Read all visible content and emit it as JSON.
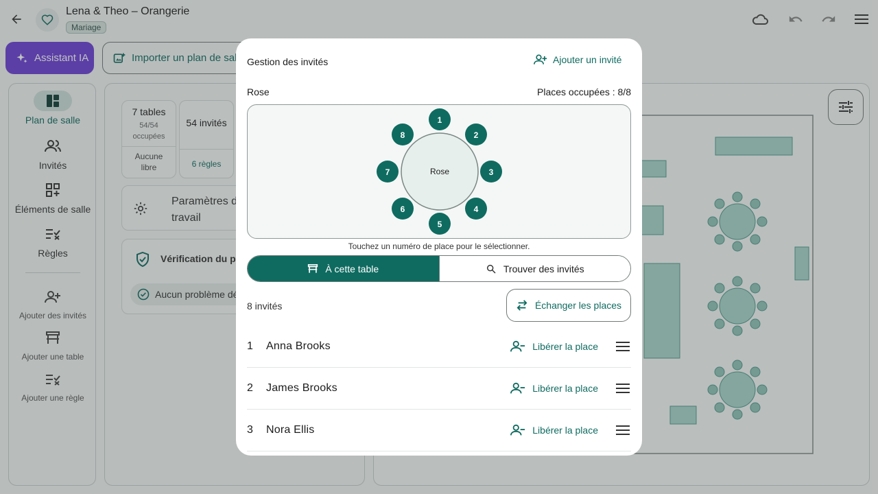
{
  "app": {
    "title": "Lena & Theo – Orangerie",
    "event_badge": "Mariage",
    "assistant_label": "Assistant IA",
    "import_label": "Importer un plan de salle"
  },
  "sidebar": {
    "items": [
      {
        "label": "Plan de salle",
        "icon": "floor-plan-icon"
      },
      {
        "label": "Invités",
        "icon": "guests-icon"
      },
      {
        "label": "Éléments de salle",
        "icon": "room-elements-icon"
      },
      {
        "label": "Règles",
        "icon": "rules-icon"
      }
    ],
    "actions": [
      {
        "label": "Ajouter des invités",
        "icon": "add-person-icon"
      },
      {
        "label": "Ajouter une table",
        "icon": "table-icon"
      },
      {
        "label": "Ajouter une règle",
        "icon": "add-rule-icon"
      }
    ]
  },
  "summary": {
    "tables": "7 tables",
    "tables_sub": "54/54 occupées",
    "tables_free": "Aucune libre",
    "guests": "54 invités",
    "rules": "6 règles",
    "settings": "Paramètres de travail",
    "settings_line1": "Paramètres d",
    "settings_line2": "travail",
    "check_title": "Vérification du plan",
    "check_status": "Aucun problème détecté"
  },
  "modal": {
    "title": "Gestion des invités",
    "add_guest": "Ajouter un invité",
    "table_name": "Rose",
    "occupied": "Places occupées : 8/8",
    "seats": [
      "1",
      "2",
      "3",
      "4",
      "5",
      "6",
      "7",
      "8"
    ],
    "hint": "Touchez un numéro de place pour le sélectionner.",
    "tab_at_table": "À cette table",
    "tab_find": "Trouver des invités",
    "guest_count": "8 invités",
    "swap_label": "Échanger les places",
    "free_label": "Libérer la place",
    "guests": [
      {
        "seat": "1",
        "name": "Anna Brooks"
      },
      {
        "seat": "2",
        "name": "James Brooks"
      },
      {
        "seat": "3",
        "name": "Nora Ellis"
      }
    ]
  },
  "colors": {
    "accent": "#0f6b60",
    "assistant": "#6b3fd6",
    "scrim": "#3c4240"
  }
}
